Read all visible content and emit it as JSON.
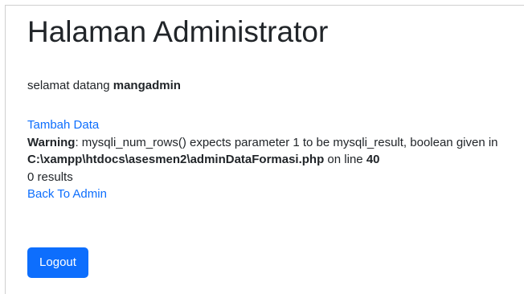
{
  "page": {
    "title": "Halaman Administrator"
  },
  "welcome": {
    "prefix": "selamat datang ",
    "username": "mangadmin"
  },
  "links": {
    "add_data": "Tambah Data",
    "back_to_admin": "Back To Admin"
  },
  "warning": {
    "label": "Warning",
    "separator": ": ",
    "message": "mysqli_num_rows() expects parameter 1 to be mysqli_result, boolean given in",
    "file_path": "C:\\xampp\\htdocs\\asesmen2\\adminDataFormasi.php",
    "on_line_text": " on line ",
    "line_number": "40"
  },
  "results": {
    "text": "0 results"
  },
  "buttons": {
    "logout": "Logout"
  },
  "colors": {
    "link": "#0d6efd",
    "button_bg": "#0d6efd",
    "text": "#212529"
  }
}
